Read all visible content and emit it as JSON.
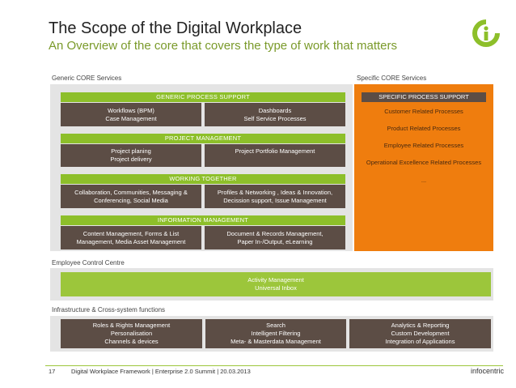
{
  "header": {
    "title": "The Scope of the Digital Workplace",
    "subtitle": "An Overview of the core that covers the type of work that matters"
  },
  "colors": {
    "accent_green": "#8dbf2a",
    "accent_orange": "#ef7d0e",
    "cell_brown": "#5c4d45"
  },
  "logo": {
    "icon": "infocentric-logo-icon"
  },
  "generic": {
    "label": "Generic CORE Services",
    "process": {
      "title": "GENERIC PROCESS SUPPORT",
      "left": [
        "Workflows (BPM)",
        "Case Management"
      ],
      "right": [
        "Dashboards",
        "Self Service Processes"
      ]
    },
    "project": {
      "title": "PROJECT MANAGEMENT",
      "left": [
        "Project planing",
        "Project delivery"
      ],
      "right": [
        "Project Portfolio Management"
      ]
    },
    "working": {
      "title": "WORKING TOGETHER",
      "left": [
        "Collaboration, Communities, Messaging &",
        "Conferencing, Social Media"
      ],
      "right": [
        "Profiles & Networking , Ideas & Innovation,",
        "Decission support, Issue Management"
      ]
    },
    "information": {
      "title": "INFORMATION MANAGEMENT",
      "left": [
        "Content Management, Forms & List",
        "Management, Media Asset Management"
      ],
      "right": [
        "Document & Records Management,",
        "Paper In-/Output, eLearning"
      ]
    }
  },
  "specific": {
    "label": "Specific CORE Services",
    "title": "SPECIFIC PROCESS SUPPORT",
    "items": [
      "Customer Related  Processes",
      "Product Related Processes",
      "Employee Related Processes",
      "Operational Excellence Related Processes",
      "..."
    ]
  },
  "employee": {
    "label": "Employee Control Centre",
    "lines": [
      "Activity Management",
      "Universal Inbox"
    ]
  },
  "infrastructure": {
    "label": "Infrastructure & Cross-system functions",
    "col1": [
      "Roles & Rights Management",
      "Personalisation",
      "Channels & devices"
    ],
    "col2": [
      "Search",
      "Intelligent Filtering",
      "Meta- & Masterdata Management"
    ],
    "col3": [
      "Analytics & Reporting",
      "Custom Development",
      "Integration of Applications"
    ]
  },
  "footer": {
    "page": "17",
    "text": "Digital Workplace Framework | Enterprise 2.0 Summit | 20.03.2013",
    "brand": "infocentric"
  }
}
